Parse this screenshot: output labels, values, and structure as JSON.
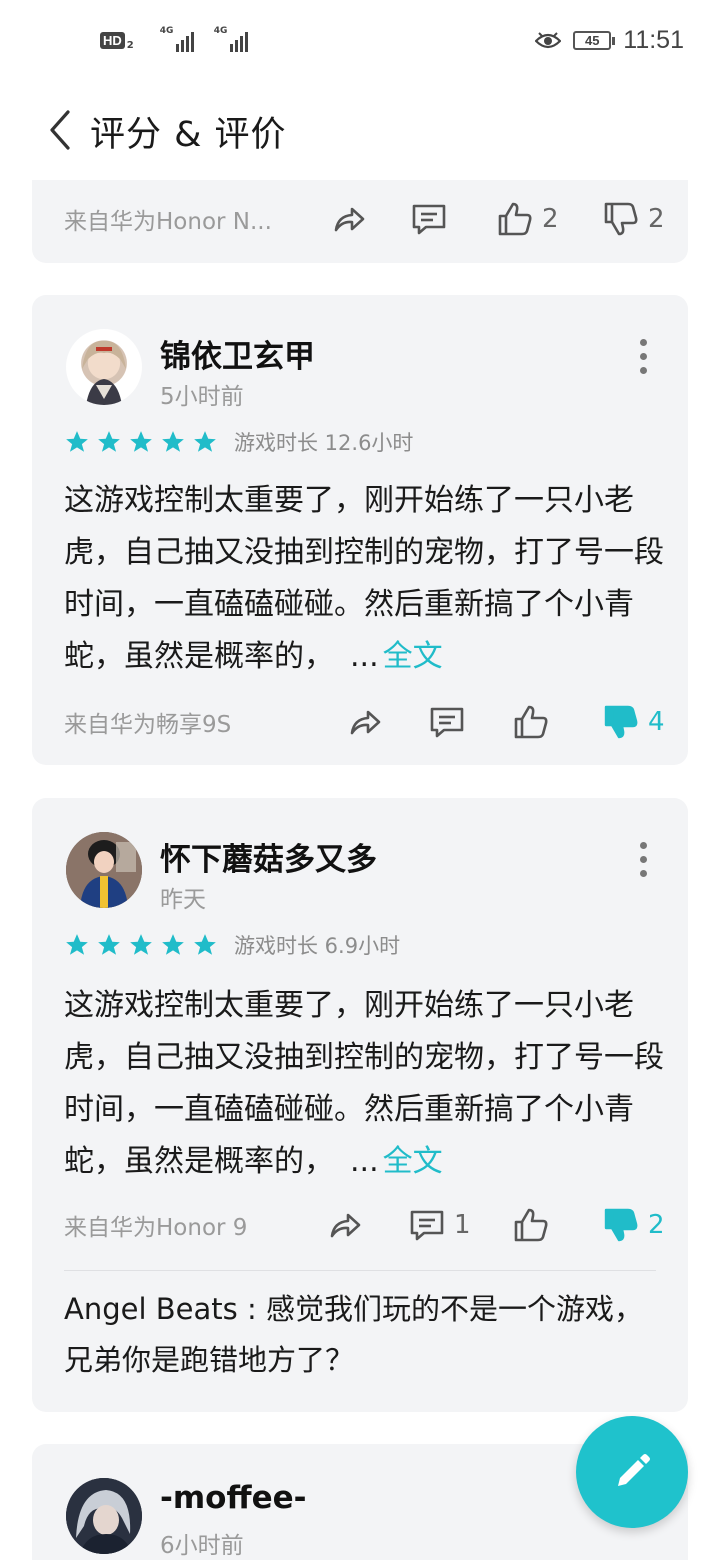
{
  "status_bar": {
    "hd_label": "HD",
    "hd_sub": "2",
    "signal1_label": "4G",
    "signal2_label": "4G",
    "battery": "45",
    "time": "11:51"
  },
  "header": {
    "title": "评分 & 评价"
  },
  "partial_review": {
    "device": "来自华为Honor N...",
    "like_count": "2",
    "dislike_count": "2"
  },
  "reviews": [
    {
      "username": "锦依卫玄甲",
      "time": "5小时前",
      "stars": 5,
      "playtime": "游戏时长 12.6小时",
      "text": "这游戏控制太重要了，刚开始练了一只小老虎，自己抽又没抽到控制的宠物，打了号一段时间，一直磕磕碰碰。然后重新搞了个小青蛇，虽然是概率的，",
      "ellipsis": "...",
      "more_label": "全文",
      "device": "来自华为畅享9S",
      "comment_count": "",
      "like_count": "",
      "dislike_count": "4",
      "dislike_active": true
    },
    {
      "username": "怀下蘑菇多又多",
      "time": "昨天",
      "stars": 5,
      "playtime": "游戏时长 6.9小时",
      "text": "这游戏控制太重要了，刚开始练了一只小老虎，自己抽又没抽到控制的宠物，打了号一段时间，一直磕磕碰碰。然后重新搞了个小青蛇，虽然是概率的，",
      "ellipsis": "...",
      "more_label": "全文",
      "device": "来自华为Honor 9",
      "comment_count": "1",
      "like_count": "",
      "dislike_count": "2",
      "dislike_active": true,
      "reply": "Angel Beats : 感觉我们玩的不是一个游戏，兄弟你是跑错地方了？"
    },
    {
      "username": "-moffee-",
      "time": "6小时前"
    }
  ],
  "colors": {
    "accent": "#20bcc9",
    "card_bg": "#f3f4f6",
    "fab": "#1fc2cc"
  },
  "icons": [
    "back-arrow-icon",
    "share-icon",
    "comment-icon",
    "thumbs-up-icon",
    "thumbs-down-icon",
    "star-icon",
    "more-vertical-icon",
    "edit-pencil-icon",
    "eye-icon"
  ]
}
